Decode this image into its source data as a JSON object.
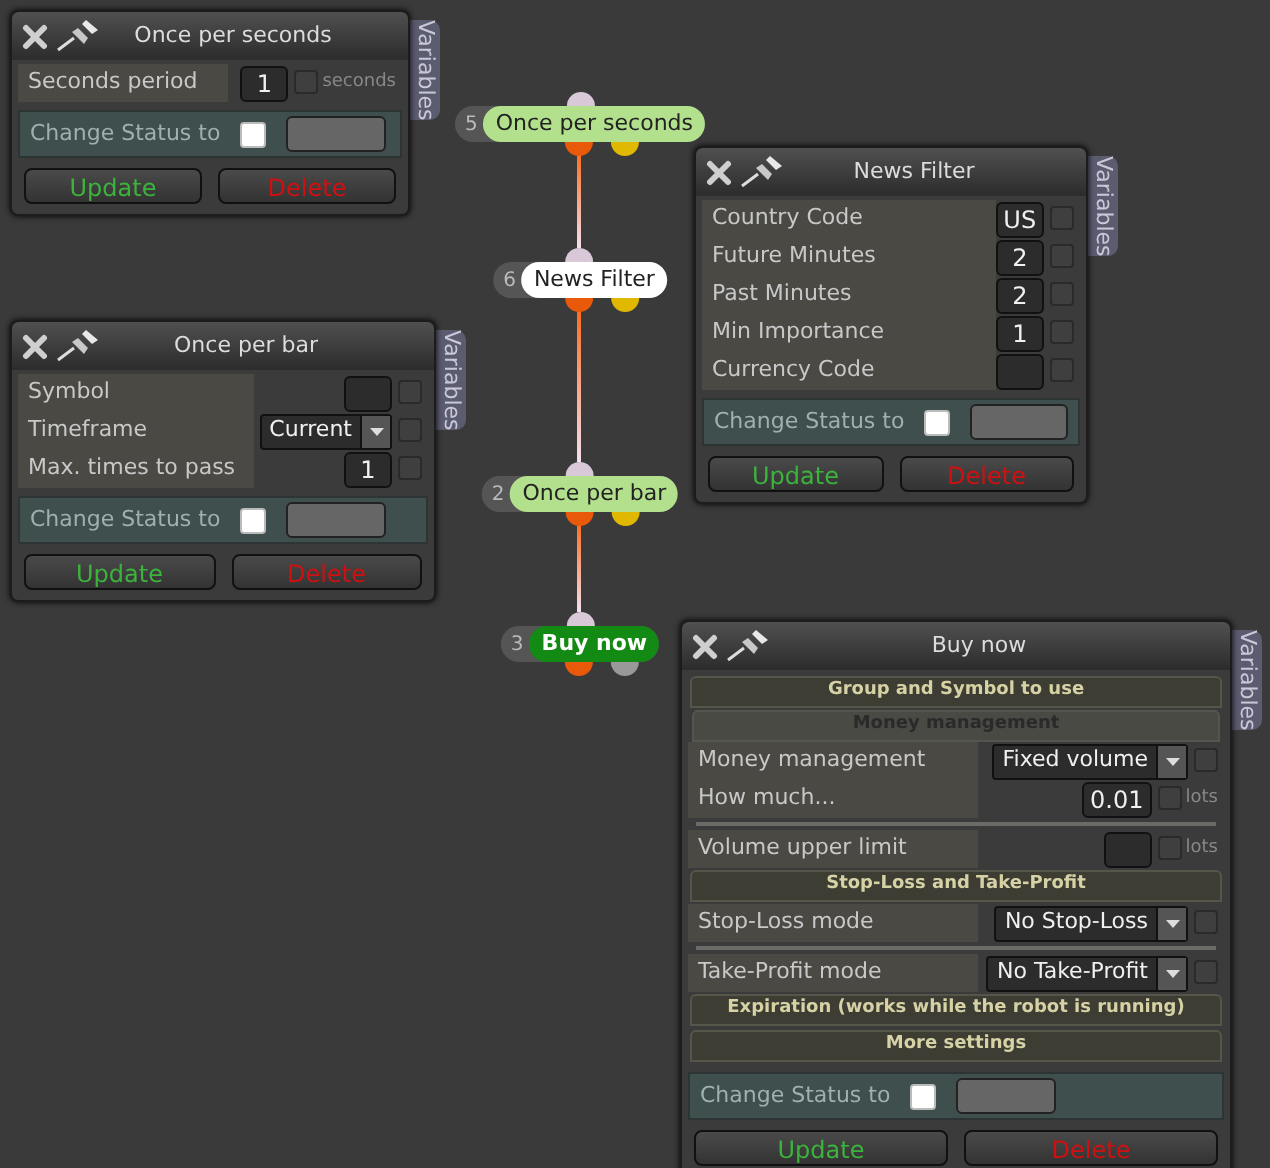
{
  "nodes": [
    {
      "number": "5",
      "label": "Once per seconds",
      "color": "#b3e08c",
      "kind": "condition"
    },
    {
      "number": "6",
      "label": "News Filter",
      "color": "#ffffff",
      "kind": "condition"
    },
    {
      "number": "2",
      "label": "Once per bar",
      "color": "#b3e08c",
      "kind": "condition"
    },
    {
      "number": "3",
      "label": "Buy now",
      "color": "#138a13",
      "kind": "action"
    }
  ],
  "panels": [
    {
      "title": "Once per seconds",
      "tab": "Variables",
      "rows": [
        {
          "kind": "input",
          "label": "Seconds period",
          "value": "1",
          "checked": false,
          "unit": "seconds"
        }
      ],
      "status": {
        "label": "Change Status to",
        "checked": false
      },
      "update": "Update",
      "delete": "Delete"
    },
    {
      "title": "News Filter",
      "tab": "Variables",
      "rows": [
        {
          "kind": "input",
          "label": "Country Code",
          "value": "US",
          "checked": false
        },
        {
          "kind": "input",
          "label": "Future Minutes",
          "value": "2",
          "checked": false
        },
        {
          "kind": "input",
          "label": "Past Minutes",
          "value": "2",
          "checked": false
        },
        {
          "kind": "input",
          "label": "Min Importance",
          "value": "1",
          "checked": false
        },
        {
          "kind": "input",
          "label": "Currency Code",
          "checked": false
        }
      ],
      "status": {
        "label": "Change Status to",
        "checked": false
      },
      "update": "Update",
      "delete": "Delete"
    },
    {
      "title": "Once per bar",
      "tab": "Variables",
      "rows": [
        {
          "kind": "input",
          "label": "Symbol",
          "checked": false
        },
        {
          "kind": "select",
          "label": "Timeframe",
          "value": "Current",
          "checked": false
        },
        {
          "kind": "input",
          "label": "Max. times to pass",
          "value": "1",
          "checked": false
        }
      ],
      "status": {
        "label": "Change Status to",
        "checked": false
      },
      "update": "Update",
      "delete": "Delete"
    },
    {
      "title": "Buy now",
      "tab": "Variables",
      "rows": [
        {
          "kind": "section",
          "label": "Group and Symbol to use"
        },
        {
          "kind": "subsection",
          "label": "Money management"
        },
        {
          "kind": "select",
          "label": "Money management",
          "value": "Fixed volume",
          "checked": false
        },
        {
          "kind": "input",
          "label": "How much...",
          "value": "0.01",
          "checked": false,
          "unit": "lots"
        },
        {
          "kind": "divider"
        },
        {
          "kind": "input",
          "label": "Volume upper limit",
          "checked": false,
          "unit": "lots"
        },
        {
          "kind": "section",
          "label": "Stop-Loss and Take-Profit"
        },
        {
          "kind": "select",
          "label": "Stop-Loss mode",
          "value": "No Stop-Loss",
          "checked": false
        },
        {
          "kind": "divider"
        },
        {
          "kind": "select",
          "label": "Take-Profit mode",
          "value": "No Take-Profit",
          "checked": false
        },
        {
          "kind": "section",
          "label": "Expiration (works while the robot is running)"
        },
        {
          "kind": "section",
          "label": "More settings"
        }
      ],
      "status": {
        "label": "Change Status to",
        "checked": false
      },
      "update": "Update",
      "delete": "Delete"
    }
  ]
}
